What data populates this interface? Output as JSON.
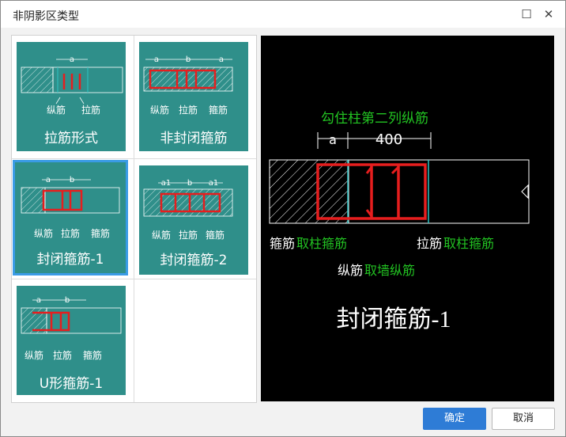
{
  "dialog": {
    "title": "非阴影区类型"
  },
  "window_controls": {
    "maximize": "☐",
    "close": "✕"
  },
  "thumbnails": [
    {
      "label": "拉筋形式",
      "dims": "a",
      "notes": [
        "纵筋",
        "拉筋"
      ]
    },
    {
      "label": "非封闭箍筋",
      "dims": [
        "a",
        "b",
        "a"
      ],
      "notes": [
        "纵筋",
        "拉筋",
        "箍筋"
      ]
    },
    {
      "label": "封闭箍筋-1",
      "dims": [
        "a",
        "b"
      ],
      "notes": [
        "纵筋",
        "拉筋",
        "箍筋"
      ],
      "selected": true
    },
    {
      "label": "封闭箍筋-2",
      "dims": [
        "a1",
        "b",
        "a1"
      ],
      "notes": [
        "纵筋",
        "拉筋",
        "箍筋"
      ]
    },
    {
      "label": "U形箍筋-1",
      "dims": [
        "a",
        "b"
      ],
      "notes": [
        "纵筋",
        "拉筋",
        "箍筋"
      ]
    }
  ],
  "preview": {
    "title": "封闭箍筋-1",
    "top_note": "勾住柱第二列纵筋",
    "dim_a": "a",
    "dim_value": "400",
    "stirrup_label": "箍筋",
    "stirrup_value": "取柱箍筋",
    "tie_label": "拉筋",
    "tie_value": "取柱箍筋",
    "long_label": "纵筋",
    "long_value": "取墙纵筋"
  },
  "colors": {
    "teal": "#2f8f8a",
    "green": "#22c322",
    "red": "#e61e1e",
    "cyan": "#2ec4c4",
    "accent": "#2e7cd6"
  },
  "buttons": {
    "ok": "确定",
    "cancel": "取消"
  }
}
